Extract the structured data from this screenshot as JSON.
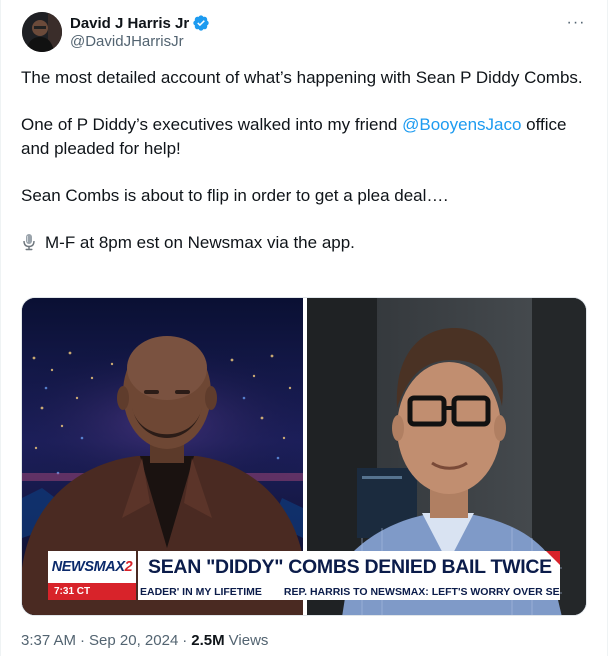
{
  "author": {
    "display_name": "David J Harris Jr",
    "handle": "@DavidJHarrisJr",
    "verified_color": "#1d9bf0",
    "avatar_icon": "profile-photo"
  },
  "more_menu_label": "···",
  "tweet_text": {
    "p1": "The most detailed account of what’s happening with Sean P Diddy Combs.",
    "p2_before": "One of P Diddy’s executives walked into my friend ",
    "p2_mention": "@BooyensJaco",
    "p2_after": " office and pleaded for help!",
    "p3": "Sean Combs is about to flip in order to get a plea deal….",
    "p4": "M-F at 8pm est on Newsmax via the app.",
    "mic_icon": "microphone-emoji"
  },
  "media": {
    "type": "video-still",
    "brand_main": "NEWSMAX",
    "brand_num": "2",
    "headline": "SEAN \"DIDDY\" COMBS DENIED BAIL TWICE",
    "time": "7:31 CT",
    "ticker_1": "EADER' IN MY LIFETIME",
    "ticker_2": "REP. HARRIS TO NEWSMAX: LEFT'S WORRY OVER SECON"
  },
  "footer": {
    "time": "3:37 AM",
    "separator": "·",
    "date": "Sep 20, 2024",
    "views_count": "2.5M",
    "views_label": "Views"
  },
  "colors": {
    "accent": "#1d9bf0",
    "text": "#0f1419",
    "muted": "#536471",
    "chyron_red": "#d8232a",
    "chyron_navy": "#0b1c4a"
  }
}
